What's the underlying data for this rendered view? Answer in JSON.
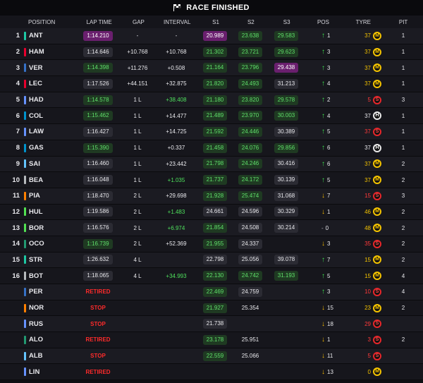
{
  "title": "RACE FINISHED",
  "columns": {
    "position": "POSITION",
    "lap_time": "LAP TIME",
    "gap": "GAP",
    "interval": "INTERVAL",
    "s1": "S1",
    "s2": "S2",
    "s3": "S3",
    "pos": "POS",
    "tyre": "TYRE",
    "pit": "PIT"
  },
  "colors": {
    "fastest_purple": "#6a1f6e",
    "personal_green": "#4ee05c",
    "retired_red": "#ff2b2b",
    "medium_yellow": "#f5c400",
    "soft_red": "#e8262a",
    "hard_white": "#e8e8e8"
  },
  "rows": [
    {
      "pos": "1",
      "team": "#1ec9a4",
      "drv": "ANT",
      "lap": "1:14.210",
      "lap_c": "purple",
      "gap": "-",
      "int": "-",
      "int_c": "",
      "s1": "20.989",
      "s1_c": "purple",
      "s2": "23.638",
      "s2_c": "green",
      "s3": "29.583",
      "s3_c": "green",
      "dir": "up",
      "chg": "1",
      "age": "37",
      "age_c": "yel",
      "tyre": "M",
      "pit": "1"
    },
    {
      "pos": "2",
      "team": "#e8002d",
      "drv": "HAM",
      "lap": "1:14.646",
      "lap_c": "",
      "gap": "+10.768",
      "int": "+10.768",
      "int_c": "",
      "s1": "21.302",
      "s1_c": "green",
      "s2": "23.721",
      "s2_c": "green",
      "s3": "29.623",
      "s3_c": "green",
      "dir": "up",
      "chg": "3",
      "age": "37",
      "age_c": "yel",
      "tyre": "M",
      "pit": "1"
    },
    {
      "pos": "3",
      "team": "#3671c6",
      "drv": "VER",
      "lap": "1:14.398",
      "lap_c": "green",
      "gap": "+11.276",
      "int": "+0.508",
      "int_c": "",
      "s1": "21.164",
      "s1_c": "green",
      "s2": "23.796",
      "s2_c": "green",
      "s3": "29.438",
      "s3_c": "purple",
      "dir": "up",
      "chg": "3",
      "age": "37",
      "age_c": "yel",
      "tyre": "M",
      "pit": "1"
    },
    {
      "pos": "4",
      "team": "#e8002d",
      "drv": "LEC",
      "lap": "1:17.526",
      "lap_c": "",
      "gap": "+44.151",
      "int": "+32.875",
      "int_c": "",
      "s1": "21.820",
      "s1_c": "green",
      "s2": "24.493",
      "s2_c": "green",
      "s3": "31.213",
      "s3_c": "grey",
      "dir": "up",
      "chg": "4",
      "age": "37",
      "age_c": "yel",
      "tyre": "M",
      "pit": "1"
    },
    {
      "pos": "5",
      "team": "#6692ff",
      "drv": "HAD",
      "lap": "1:14.578",
      "lap_c": "green",
      "gap": "1 L",
      "int": "+38.408",
      "int_c": "green",
      "s1": "21.180",
      "s1_c": "green",
      "s2": "23.820",
      "s2_c": "green",
      "s3": "29.578",
      "s3_c": "green",
      "dir": "up",
      "chg": "2",
      "age": "5",
      "age_c": "red",
      "tyre": "S",
      "pit": "3"
    },
    {
      "pos": "6",
      "team": "#0093cc",
      "drv": "COL",
      "lap": "1:15.462",
      "lap_c": "green",
      "gap": "1 L",
      "int": "+14.477",
      "int_c": "",
      "s1": "21.489",
      "s1_c": "green",
      "s2": "23.970",
      "s2_c": "green",
      "s3": "30.003",
      "s3_c": "green",
      "dir": "up",
      "chg": "4",
      "age": "37",
      "age_c": "wht",
      "tyre": "H",
      "pit": "1"
    },
    {
      "pos": "7",
      "team": "#6692ff",
      "drv": "LAW",
      "lap": "1:16.427",
      "lap_c": "",
      "gap": "1 L",
      "int": "+14.725",
      "int_c": "",
      "s1": "21.592",
      "s1_c": "green",
      "s2": "24.446",
      "s2_c": "green",
      "s3": "30.389",
      "s3_c": "grey",
      "dir": "up",
      "chg": "5",
      "age": "37",
      "age_c": "red",
      "tyre": "S",
      "pit": "1"
    },
    {
      "pos": "8",
      "team": "#0093cc",
      "drv": "GAS",
      "lap": "1:15.390",
      "lap_c": "green",
      "gap": "1 L",
      "int": "+0.337",
      "int_c": "",
      "s1": "21.458",
      "s1_c": "green",
      "s2": "24.076",
      "s2_c": "green",
      "s3": "29.856",
      "s3_c": "green",
      "dir": "up",
      "chg": "6",
      "age": "37",
      "age_c": "wht",
      "tyre": "H",
      "pit": "1"
    },
    {
      "pos": "9",
      "team": "#64c4ff",
      "drv": "SAI",
      "lap": "1:16.460",
      "lap_c": "",
      "gap": "1 L",
      "int": "+23.442",
      "int_c": "",
      "s1": "21.798",
      "s1_c": "green",
      "s2": "24.246",
      "s2_c": "green",
      "s3": "30.416",
      "s3_c": "grey",
      "dir": "up",
      "chg": "6",
      "age": "37",
      "age_c": "yel",
      "tyre": "M",
      "pit": "2"
    },
    {
      "pos": "10",
      "team": "#b6babd",
      "drv": "BEA",
      "lap": "1:16.048",
      "lap_c": "",
      "gap": "1 L",
      "int": "+1.035",
      "int_c": "green",
      "s1": "21.737",
      "s1_c": "green",
      "s2": "24.172",
      "s2_c": "green",
      "s3": "30.139",
      "s3_c": "grey",
      "dir": "up",
      "chg": "5",
      "age": "37",
      "age_c": "yel",
      "tyre": "M",
      "pit": "2"
    },
    {
      "pos": "11",
      "team": "#ff8000",
      "drv": "PIA",
      "lap": "1:18.470",
      "lap_c": "",
      "gap": "2 L",
      "int": "+29.698",
      "int_c": "",
      "s1": "21.928",
      "s1_c": "green",
      "s2": "25.474",
      "s2_c": "green",
      "s3": "31.068",
      "s3_c": "grey",
      "dir": "down",
      "chg": "7",
      "age": "15",
      "age_c": "red",
      "tyre": "S",
      "pit": "3"
    },
    {
      "pos": "12",
      "team": "#52e252",
      "drv": "HUL",
      "lap": "1:19.586",
      "lap_c": "",
      "gap": "2 L",
      "int": "+1.483",
      "int_c": "green",
      "s1": "24.661",
      "s1_c": "grey",
      "s2": "24.596",
      "s2_c": "grey",
      "s3": "30.329",
      "s3_c": "grey",
      "dir": "down",
      "chg": "1",
      "age": "46",
      "age_c": "yel",
      "tyre": "M",
      "pit": "2"
    },
    {
      "pos": "13",
      "team": "#52e252",
      "drv": "BOR",
      "lap": "1:16.576",
      "lap_c": "",
      "gap": "2 L",
      "int": "+6.974",
      "int_c": "green",
      "s1": "21.854",
      "s1_c": "green",
      "s2": "24.508",
      "s2_c": "grey",
      "s3": "30.214",
      "s3_c": "grey",
      "dir": "none",
      "chg": "0",
      "age": "48",
      "age_c": "yel",
      "tyre": "M",
      "pit": "2"
    },
    {
      "pos": "14",
      "team": "#229971",
      "drv": "OCO",
      "lap": "1:16.739",
      "lap_c": "green",
      "gap": "2 L",
      "int": "+52.369",
      "int_c": "",
      "s1": "21.955",
      "s1_c": "green",
      "s2": "24.337",
      "s2_c": "grey",
      "s3": "",
      "s3_c": "",
      "dir": "down",
      "chg": "3",
      "age": "35",
      "age_c": "red",
      "tyre": "S",
      "pit": "2"
    },
    {
      "pos": "15",
      "team": "#1ec9a4",
      "drv": "STR",
      "lap": "1:26.632",
      "lap_c": "",
      "gap": "4 L",
      "int": "",
      "int_c": "",
      "s1": "22.798",
      "s1_c": "grey",
      "s2": "25.056",
      "s2_c": "grey",
      "s3": "39.078",
      "s3_c": "grey",
      "dir": "up",
      "chg": "7",
      "age": "15",
      "age_c": "yel",
      "tyre": "M",
      "pit": "2"
    },
    {
      "pos": "16",
      "team": "#b6babd",
      "drv": "BOT",
      "lap": "1:18.065",
      "lap_c": "",
      "gap": "4 L",
      "int": "+34.993",
      "int_c": "green",
      "s1": "22.130",
      "s1_c": "green",
      "s2": "24.742",
      "s2_c": "green",
      "s3": "31.193",
      "s3_c": "green",
      "dir": "up",
      "chg": "5",
      "age": "15",
      "age_c": "yel",
      "tyre": "M",
      "pit": "4"
    },
    {
      "pos": "",
      "team": "#3671c6",
      "drv": "PER",
      "lap": "RETIRED",
      "lap_c": "retired",
      "gap": "",
      "int": "",
      "int_c": "",
      "s1": "22.469",
      "s1_c": "green",
      "s2": "24.759",
      "s2_c": "grey",
      "s3": "",
      "s3_c": "",
      "dir": "up",
      "chg": "3",
      "age": "10",
      "age_c": "red",
      "tyre": "S",
      "pit": "4"
    },
    {
      "pos": "",
      "team": "#ff8000",
      "drv": "NOR",
      "lap": "STOP",
      "lap_c": "retired",
      "gap": "",
      "int": "",
      "int_c": "",
      "s1": "21.927",
      "s1_c": "green",
      "s2": "25.354",
      "s2_c": "",
      "s3": "",
      "s3_c": "",
      "dir": "down",
      "chg": "15",
      "age": "23",
      "age_c": "yel",
      "tyre": "M",
      "pit": "2"
    },
    {
      "pos": "",
      "team": "#6692ff",
      "drv": "RUS",
      "lap": "STOP",
      "lap_c": "retired",
      "gap": "",
      "int": "",
      "int_c": "",
      "s1": "21.738",
      "s1_c": "grey",
      "s2": "",
      "s2_c": "",
      "s3": "",
      "s3_c": "",
      "dir": "down",
      "chg": "18",
      "age": "29",
      "age_c": "red",
      "tyre": "S",
      "pit": ""
    },
    {
      "pos": "",
      "team": "#229971",
      "drv": "ALO",
      "lap": "RETIRED",
      "lap_c": "retired",
      "gap": "",
      "int": "",
      "int_c": "",
      "s1": "23.178",
      "s1_c": "green",
      "s2": "25.951",
      "s2_c": "",
      "s3": "",
      "s3_c": "",
      "dir": "down",
      "chg": "1",
      "age": "3",
      "age_c": "red",
      "tyre": "S",
      "pit": "2"
    },
    {
      "pos": "",
      "team": "#64c4ff",
      "drv": "ALB",
      "lap": "STOP",
      "lap_c": "retired",
      "gap": "",
      "int": "",
      "int_c": "",
      "s1": "22.559",
      "s1_c": "green",
      "s2": "25.066",
      "s2_c": "",
      "s3": "",
      "s3_c": "",
      "dir": "down",
      "chg": "11",
      "age": "5",
      "age_c": "red",
      "tyre": "S",
      "pit": ""
    },
    {
      "pos": "",
      "team": "#6692ff",
      "drv": "LIN",
      "lap": "RETIRED",
      "lap_c": "retired",
      "gap": "",
      "int": "",
      "int_c": "",
      "s1": "",
      "s1_c": "",
      "s2": "",
      "s2_c": "",
      "s3": "",
      "s3_c": "",
      "dir": "down",
      "chg": "13",
      "age": "0",
      "age_c": "yel",
      "tyre": "M",
      "pit": ""
    }
  ]
}
